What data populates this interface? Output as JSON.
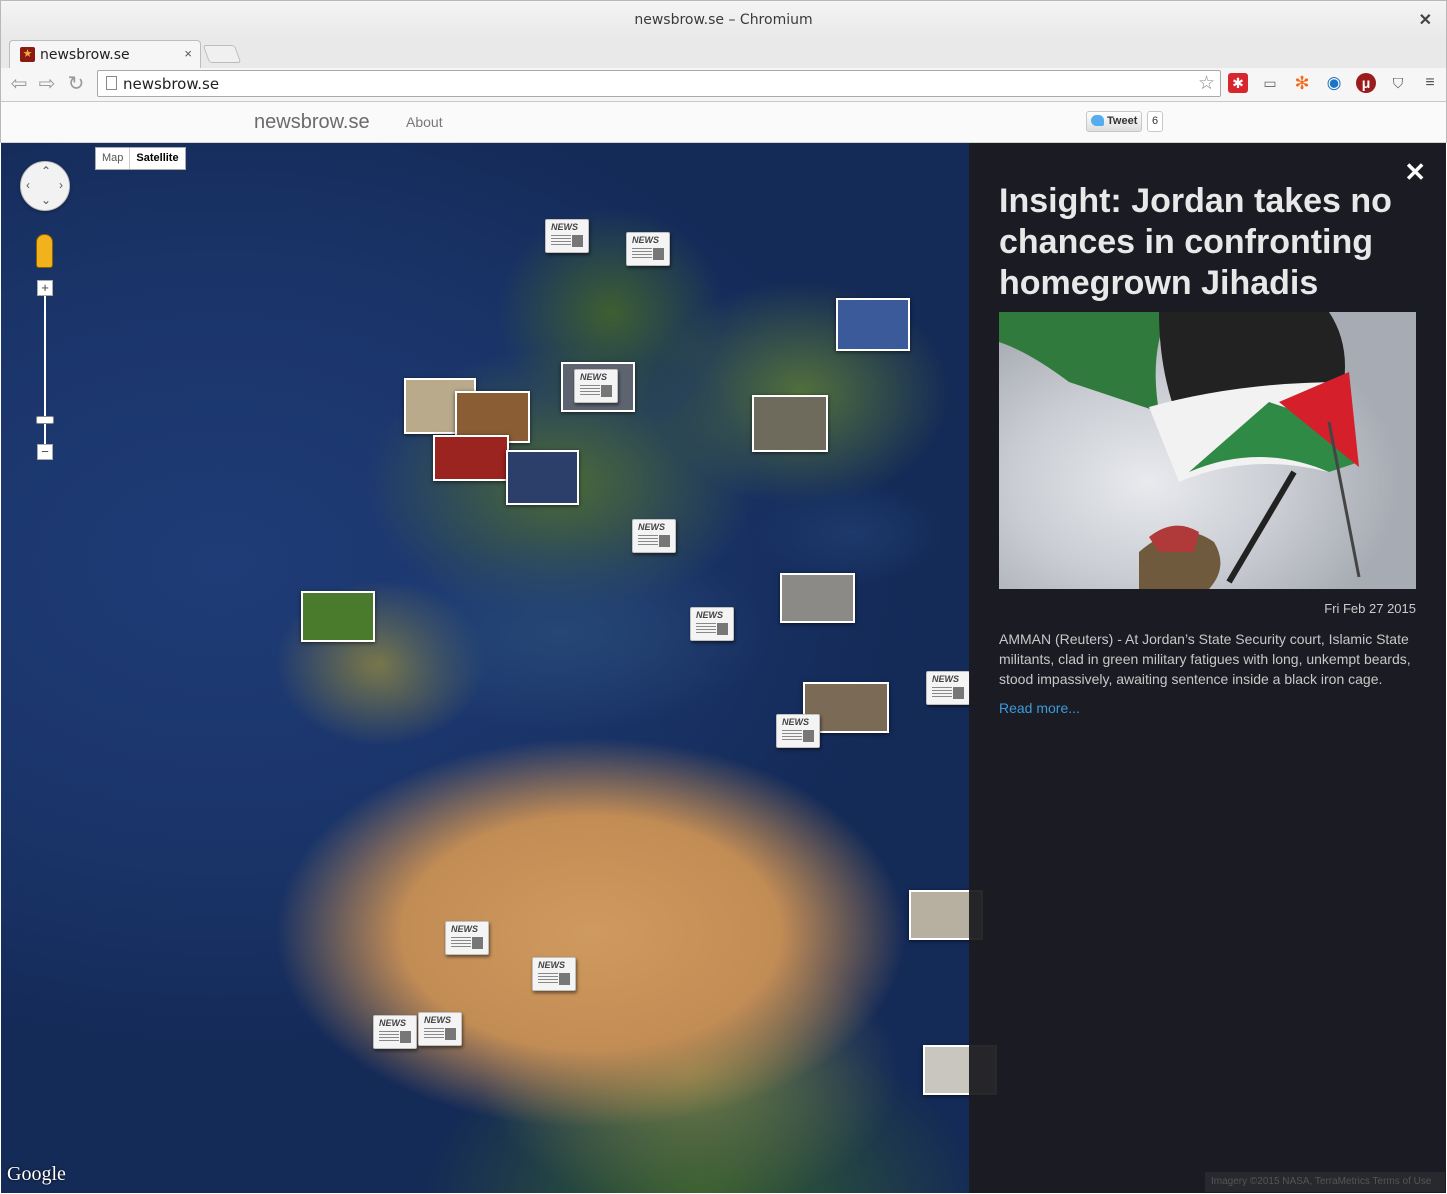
{
  "window": {
    "title": "newsbrow.se – Chromium"
  },
  "tab": {
    "title": "newsbrow.se",
    "close": "×"
  },
  "address": {
    "url": "newsbrow.se"
  },
  "site": {
    "brand": "newsbrow.se",
    "about": "About",
    "tweet": "Tweet",
    "tweet_count": "6"
  },
  "map": {
    "type_map": "Map",
    "type_satellite": "Satellite",
    "selected_type": "Satellite",
    "zoom_in": "+",
    "zoom_out": "−",
    "logo": "Google",
    "news_label": "NEWS",
    "attribution": "Imagery ©2015 NASA, TerraMetrics   Terms of Use"
  },
  "article": {
    "title": "Insight: Jordan takes no chances in confronting homegrown Jihadis",
    "date": "Fri Feb 27 2015",
    "body": "AMMAN (Reuters) - At Jordan’s State Security court, Islamic State militants, clad in green military fatigues with long, unkempt beards, stood impassively, awaiting sentence inside a black iron cage.",
    "read_more": "Read more...",
    "close": "✕"
  },
  "icons": [
    "back-icon",
    "forward-icon",
    "reload-icon",
    "star-icon",
    "pegman-icon",
    "close-icon"
  ],
  "colors": {
    "panel_bg": "#1c1c20",
    "link": "#3a9bdc",
    "ocean": "#1a3468"
  }
}
